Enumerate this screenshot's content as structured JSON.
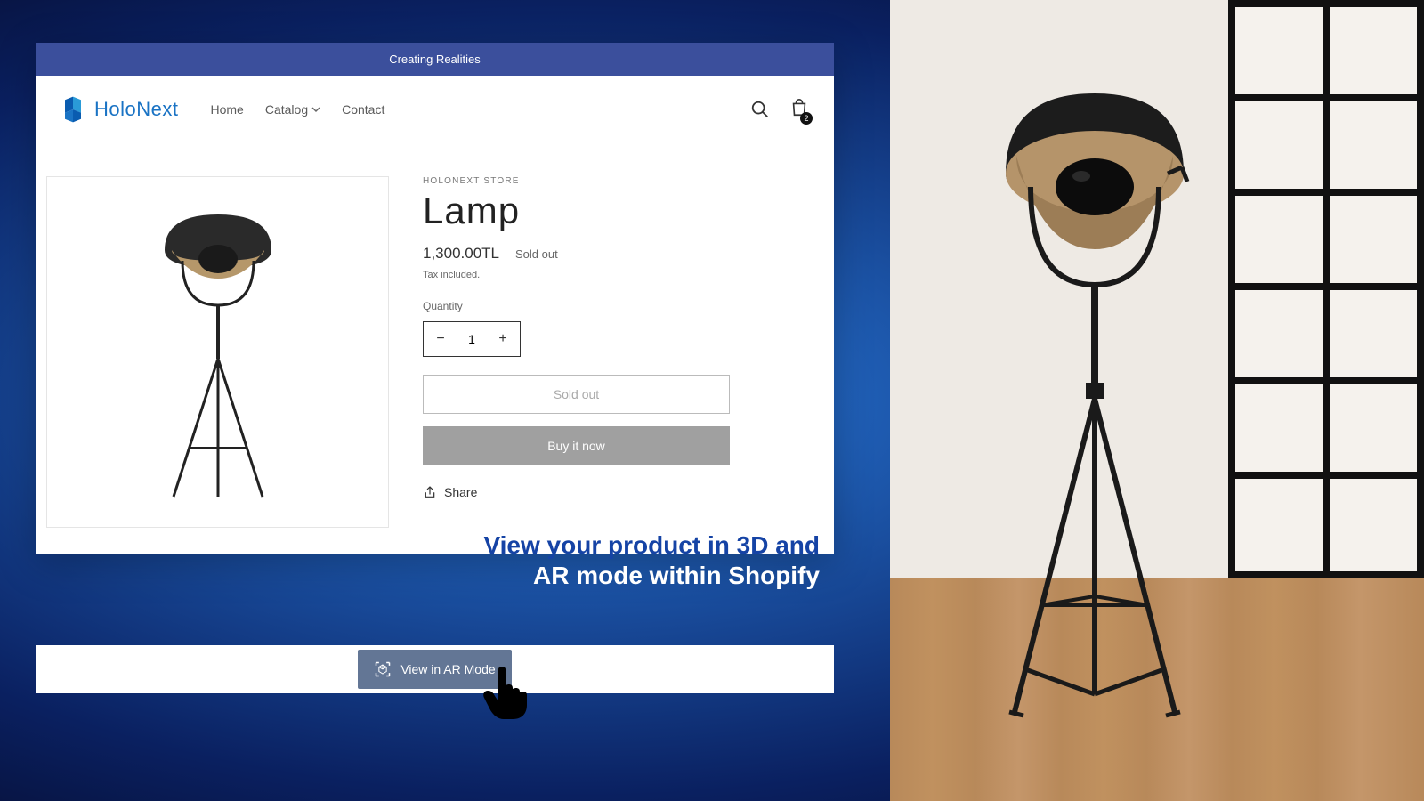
{
  "announce": "Creating Realities",
  "logo_text": "HoloNext",
  "nav": {
    "home": "Home",
    "catalog": "Catalog",
    "contact": "Contact"
  },
  "cart_count": "2",
  "product": {
    "vendor": "HOLONEXT STORE",
    "title": "Lamp",
    "price": "1,300.00TL",
    "soldout": "Sold out",
    "tax": "Tax included.",
    "qty_label": "Quantity",
    "qty_value": "1",
    "btn_soldout": "Sold out",
    "btn_buy": "Buy it now",
    "share": "Share"
  },
  "tagline": {
    "line1": "View your product in 3D and",
    "line2": "AR mode within Shopify"
  },
  "ar_button": "View in AR Mode"
}
